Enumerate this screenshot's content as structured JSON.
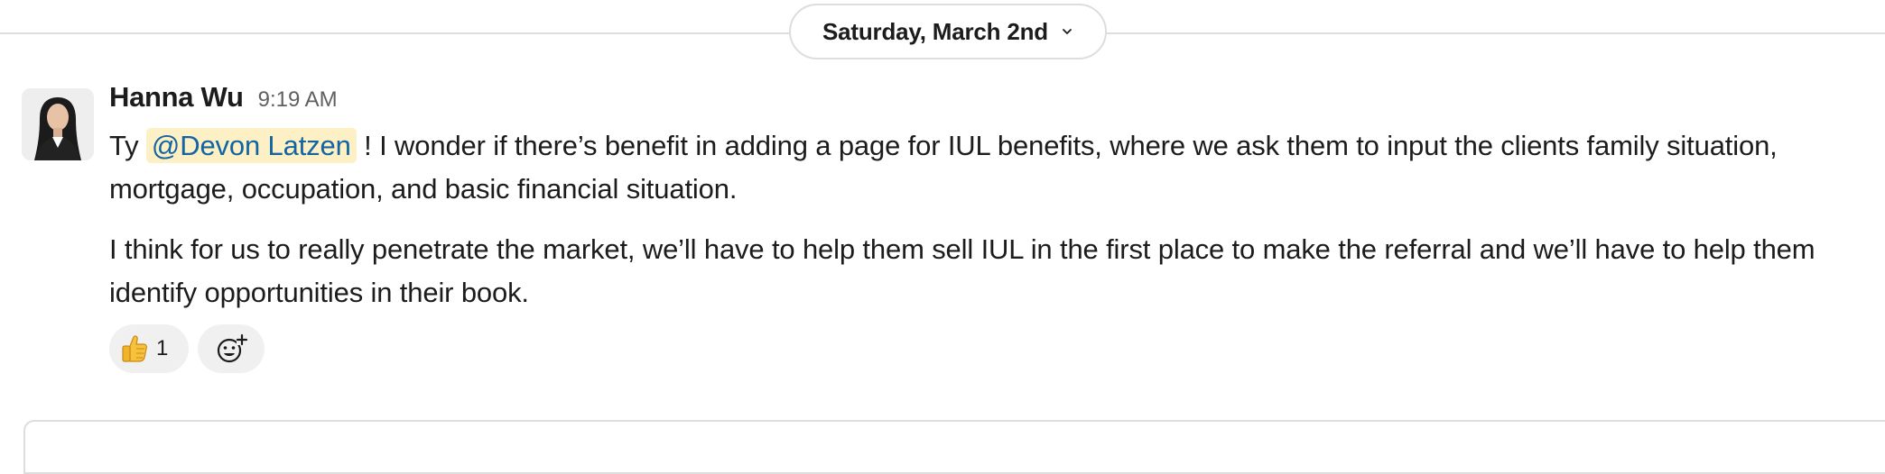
{
  "day_divider": {
    "label": "Saturday, March 2nd"
  },
  "message": {
    "author": "Hanna Wu",
    "time": "9:19 AM",
    "paragraph1": {
      "before": "Ty ",
      "mention": "@Devon Latzen",
      "after": " ! I wonder if there’s benefit in adding a page for IUL benefits, where we ask them to input the clients family situation, mortgage, occupation, and basic financial situation."
    },
    "paragraph2": "I think for us to really penetrate the market, we’ll have to help them sell IUL in the first place to make the referral and we’ll have to help them identify opportunities in their book.",
    "reactions": [
      {
        "emoji": "thumbs-up",
        "glyph": "👍",
        "count": "1"
      }
    ],
    "add_reaction_icon": "add-reaction-icon"
  },
  "colors": {
    "mention_bg": "#fdf0c4",
    "mention_text": "#1264a3",
    "reaction_bg": "#f0f0f0",
    "divider": "#dddddd"
  }
}
